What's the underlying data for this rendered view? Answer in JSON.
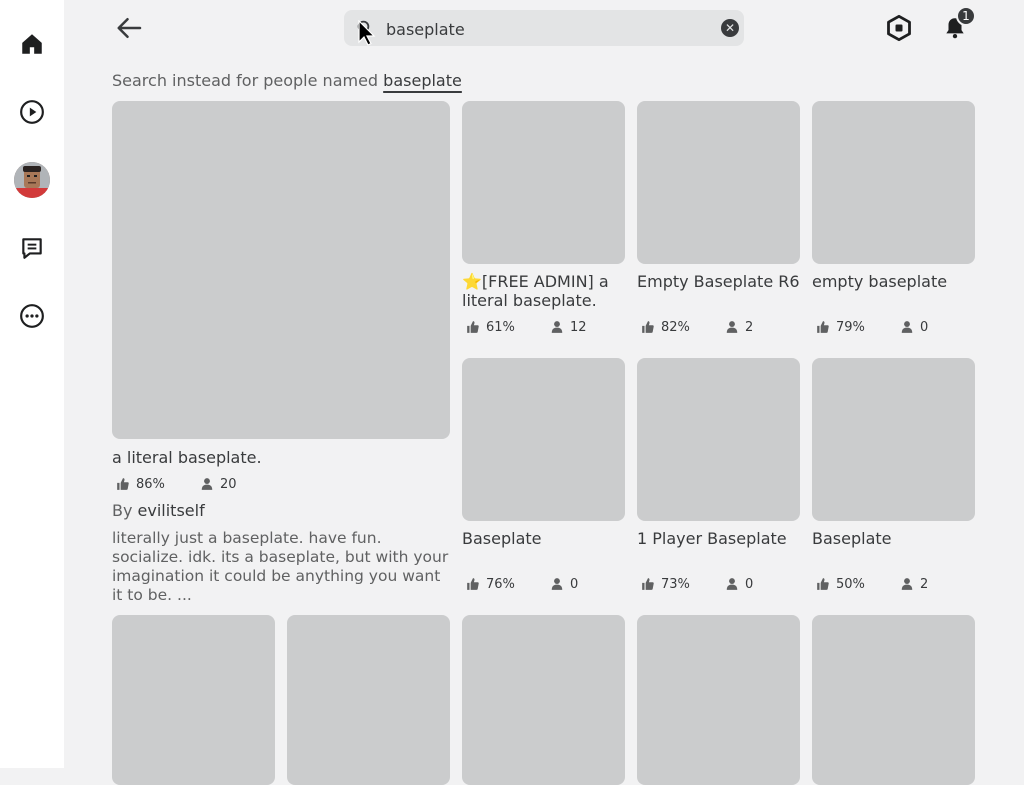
{
  "search": {
    "value": "baseplate",
    "placeholder": "Search"
  },
  "alt_search": {
    "prefix": "Search instead for people named ",
    "link": "baseplate"
  },
  "notifications": {
    "count": "1"
  },
  "sidebar": {
    "items": [
      {
        "name": "home",
        "icon": "home-icon"
      },
      {
        "name": "play",
        "icon": "play-circle-icon"
      },
      {
        "name": "avatar",
        "icon": "avatar"
      },
      {
        "name": "chat",
        "icon": "chat-icon"
      },
      {
        "name": "more",
        "icon": "more-icon"
      }
    ]
  },
  "featured": {
    "title": "a literal baseplate.",
    "rating": "86%",
    "players": "20",
    "by_label": "By ",
    "creator": "evilitself",
    "description": "literally just a baseplate. have fun. socialize. idk. its a baseplate, but with your imagination it could be anything you want it to be. ..."
  },
  "games": [
    {
      "title": "⭐[FREE ADMIN] a literal baseplate.",
      "rating": "61%",
      "players": "12"
    },
    {
      "title": "Empty Baseplate R6",
      "rating": "82%",
      "players": "2"
    },
    {
      "title": "empty baseplate",
      "rating": "79%",
      "players": "0"
    },
    {
      "title": "Baseplate",
      "rating": "76%",
      "players": "0"
    },
    {
      "title": "1 Player Baseplate",
      "rating": "73%",
      "players": "0"
    },
    {
      "title": "Baseplate",
      "rating": "50%",
      "players": "2"
    }
  ],
  "colors": {
    "thumbnail": "#cbcccd",
    "background": "#f2f2f3",
    "text": "#393b3d"
  }
}
